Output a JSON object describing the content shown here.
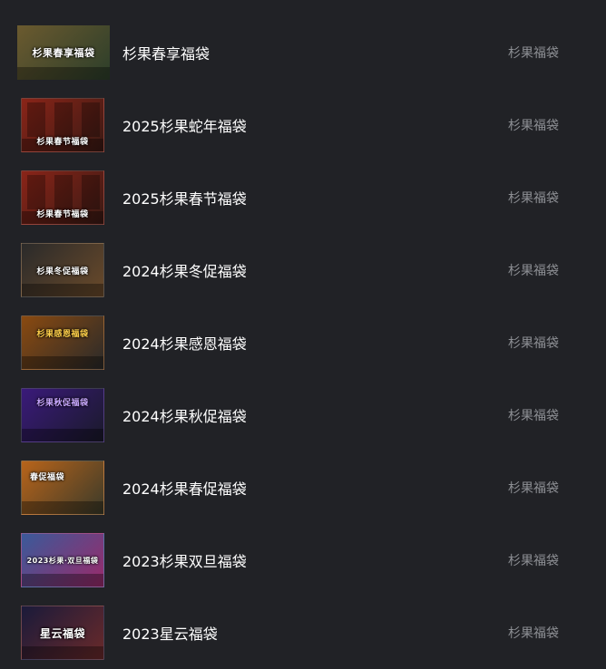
{
  "items": [
    {
      "title": "杉果春享福袋",
      "tag": "杉果福袋",
      "thumb_text": "杉果春享福袋",
      "thumb_colors": [
        "#6b5a2f",
        "#2c3e2a"
      ],
      "thumb_style": "first"
    },
    {
      "title": "2025杉果蛇年福袋",
      "tag": "杉果福袋",
      "thumb_text": "杉果春节福袋",
      "thumb_colors": [
        "#8a2418",
        "#3a1a14"
      ],
      "thumb_style": "std"
    },
    {
      "title": "2025杉果春节福袋",
      "tag": "杉果福袋",
      "thumb_text": "杉果春节福袋",
      "thumb_colors": [
        "#8a2418",
        "#3a1a14"
      ],
      "thumb_style": "std"
    },
    {
      "title": "2024杉果冬促福袋",
      "tag": "杉果福袋",
      "thumb_text": "杉果冬促福袋",
      "thumb_colors": [
        "#2a2a2a",
        "#6a4a2a"
      ],
      "thumb_style": "std"
    },
    {
      "title": "2024杉果感恩福袋",
      "tag": "杉果福袋",
      "thumb_text": "杉果感恩福袋",
      "thumb_colors": [
        "#8a4a10",
        "#2a2a2a"
      ],
      "thumb_style": "std"
    },
    {
      "title": "2024杉果秋促福袋",
      "tag": "杉果福袋",
      "thumb_text": "杉果秋促福袋",
      "thumb_colors": [
        "#3a1a7a",
        "#1a1a2a"
      ],
      "thumb_style": "std"
    },
    {
      "title": "2024杉果春促福袋",
      "tag": "杉果福袋",
      "thumb_text": "春促福袋",
      "thumb_colors": [
        "#b8641a",
        "#3a3a2a"
      ],
      "thumb_style": "std"
    },
    {
      "title": "2023杉果双旦福袋",
      "tag": "杉果福袋",
      "thumb_text": "2023杉果·双旦福袋",
      "thumb_colors": [
        "#3a5a9a",
        "#9a2a6a"
      ],
      "thumb_style": "std"
    },
    {
      "title": "2023星云福袋",
      "tag": "杉果福袋",
      "thumb_text": "星云福袋",
      "thumb_colors": [
        "#1a1a3a",
        "#6a2a2a"
      ],
      "thumb_style": "std"
    }
  ]
}
